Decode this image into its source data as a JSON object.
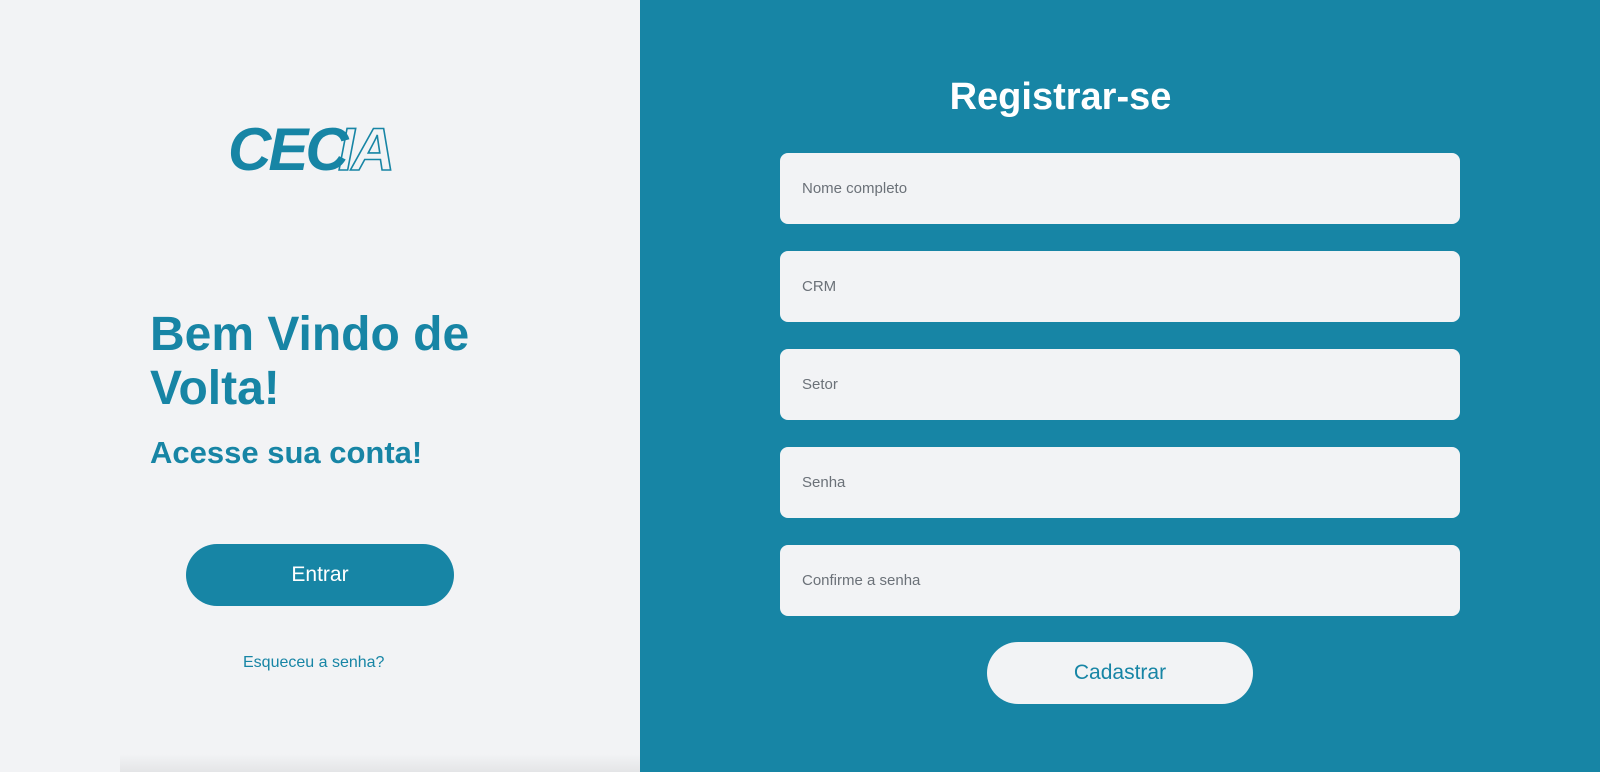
{
  "brand": {
    "logo_solid": "CEC",
    "logo_outline": "IA",
    "color": "#1785a5"
  },
  "login_panel": {
    "heading": "Bem Vindo de Volta!",
    "subheading": "Acesse sua conta!",
    "enter_button": "Entrar",
    "forgot_link": "Esqueceu a senha?"
  },
  "register_panel": {
    "title": "Registrar-se",
    "fields": {
      "full_name_placeholder": "Nome completo",
      "crm_placeholder": "CRM",
      "sector_placeholder": "Setor",
      "password_placeholder": "Senha",
      "confirm_password_placeholder": "Confirme a senha"
    },
    "submit_button": "Cadastrar"
  },
  "colors": {
    "accent": "#1785a5",
    "light_background": "#f2f3f5",
    "text_on_accent": "#ffffff"
  }
}
